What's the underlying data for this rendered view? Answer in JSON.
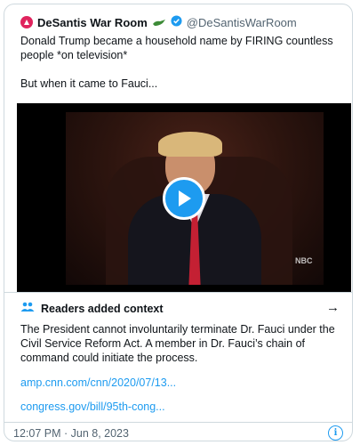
{
  "tweet": {
    "author_name": "DeSantis War Room",
    "handle": "@DeSantisWarRoom",
    "text_line1": "Donald Trump became a household name by FIRING countless people *on television*",
    "text_line2": "But when it came to Fauci..."
  },
  "media": {
    "watermark": "NBC"
  },
  "context": {
    "title": "Readers added context",
    "body": "The President cannot involuntarily terminate Dr. Fauci under the Civil Service Reform Act. A member in Dr. Fauci’s chain of command could initiate the process.",
    "links": [
      "amp.cnn.com/cnn/2020/07/13...",
      "congress.gov/bill/95th-cong..."
    ]
  },
  "footer": {
    "timestamp": "12:07 PM · Jun 8, 2023"
  },
  "colors": {
    "accent": "#1d9bf0",
    "logo": "#e0245e",
    "text": "#0f1419",
    "secondary": "#536471"
  }
}
